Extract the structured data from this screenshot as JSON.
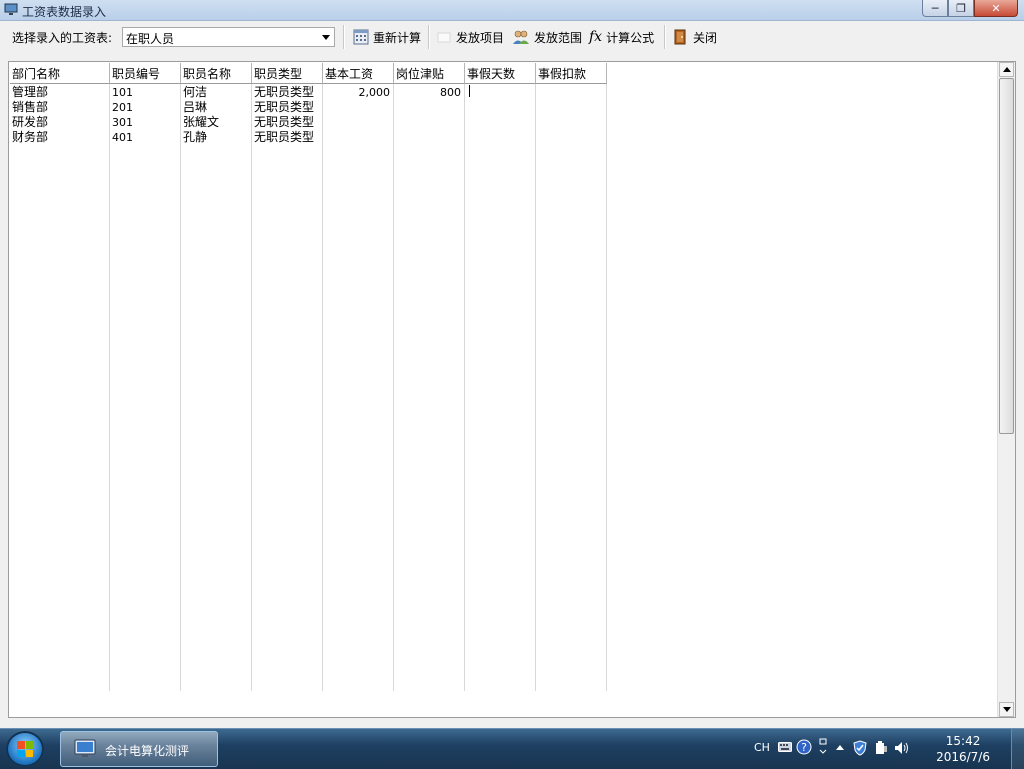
{
  "window": {
    "title": "工资表数据录入",
    "buttons": {
      "minimize": "─",
      "restore": "❐",
      "close": "✕"
    }
  },
  "toolbar": {
    "select_label": "选择录入的工资表:",
    "selected_table": "在职人员",
    "recalculate": "重新计算",
    "pay_items": "发放项目",
    "pay_scope": "发放范围",
    "formula_fx": "fx",
    "formula": "计算公式",
    "close": "关闭"
  },
  "grid": {
    "columns": [
      "部门名称",
      "职员编号",
      "职员名称",
      "职员类型",
      "基本工资",
      "岗位津贴",
      "事假天数",
      "事假扣款"
    ],
    "rows": [
      {
        "dept": "管理部",
        "id": "101",
        "name": "何洁",
        "type": "无职员类型",
        "base": "2,000",
        "allowance": "800",
        "leave_days": "",
        "leave_deduct": ""
      },
      {
        "dept": "销售部",
        "id": "201",
        "name": "吕琳",
        "type": "无职员类型",
        "base": "",
        "allowance": "",
        "leave_days": "",
        "leave_deduct": ""
      },
      {
        "dept": "研发部",
        "id": "301",
        "name": "张耀文",
        "type": "无职员类型",
        "base": "",
        "allowance": "",
        "leave_days": "",
        "leave_deduct": ""
      },
      {
        "dept": "财务部",
        "id": "401",
        "name": "孔静",
        "type": "无职员类型",
        "base": "",
        "allowance": "",
        "leave_days": "",
        "leave_deduct": ""
      }
    ]
  },
  "taskbar": {
    "task_label": "会计电算化测评",
    "lang": "CH",
    "time": "15:42",
    "date": "2016/7/6"
  },
  "colors": {
    "titlebar": "#c4d6ec",
    "taskbar": "#1e4063",
    "grid_bg": "#ffffff"
  },
  "icons": [
    "app-window-icon",
    "calculator-grid-icon",
    "checkbox-icon",
    "people-icon",
    "fx-icon",
    "exit-door-icon",
    "windows-start-icon",
    "monitor-icon",
    "keyboard-icon",
    "help-icon",
    "shield-icon",
    "speaker-icon"
  ]
}
